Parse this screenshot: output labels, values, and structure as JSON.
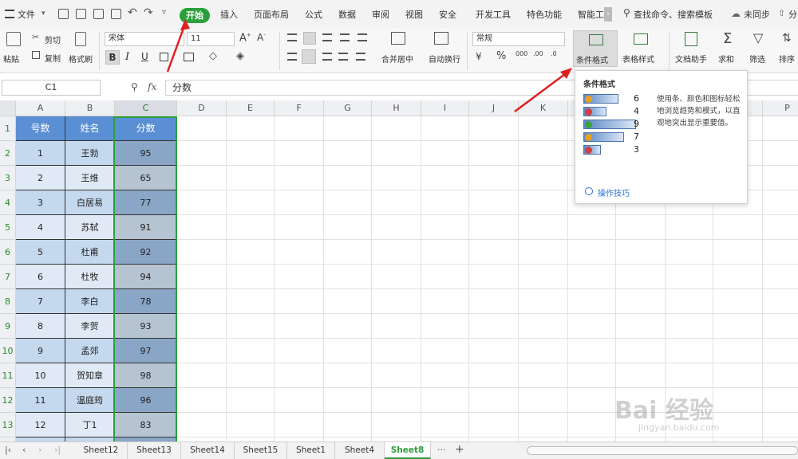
{
  "menu": {
    "file": "文件",
    "tabs": [
      "开始",
      "插入",
      "页面布局",
      "公式",
      "数据",
      "审阅",
      "视图",
      "安全",
      "开发工具",
      "特色功能",
      "智能工"
    ],
    "search": "查找命令、搜索模板",
    "sync": "未同步",
    "share": "分"
  },
  "ribbon": {
    "paste": "粘贴",
    "cut": "剪切",
    "copy": "复制",
    "format_painter": "格式刷",
    "font_name": "宋体",
    "font_size": "11",
    "merge_center": "合并居中",
    "auto_wrap": "自动换行",
    "number_format": "常规",
    "cond_format": "条件格式",
    "table_style": "表格样式",
    "doc_assistant": "文档助手",
    "sum": "求和",
    "filter": "筛选",
    "sort": "排序"
  },
  "formula_bar": {
    "cell_ref": "C1",
    "fx": "fx",
    "content": "分数"
  },
  "columns": [
    "A",
    "B",
    "C",
    "D",
    "E",
    "F",
    "G",
    "H",
    "I",
    "J",
    "K",
    "L",
    "M",
    "N",
    "O",
    "P"
  ],
  "rows": [
    "1",
    "2",
    "3",
    "4",
    "5",
    "6",
    "7",
    "8",
    "9",
    "10",
    "11",
    "12",
    "13"
  ],
  "table": {
    "headers": [
      "号数",
      "姓名",
      "分数"
    ],
    "rows": [
      [
        "1",
        "王勃",
        "95"
      ],
      [
        "2",
        "王维",
        "65"
      ],
      [
        "3",
        "白居易",
        "77"
      ],
      [
        "4",
        "苏轼",
        "91"
      ],
      [
        "5",
        "杜甫",
        "92"
      ],
      [
        "6",
        "杜牧",
        "94"
      ],
      [
        "7",
        "李白",
        "78"
      ],
      [
        "8",
        "李贺",
        "93"
      ],
      [
        "9",
        "孟郊",
        "97"
      ],
      [
        "10",
        "贺知章",
        "98"
      ],
      [
        "11",
        "温庭筠",
        "96"
      ],
      [
        "12",
        "丁1",
        "83"
      ]
    ]
  },
  "tooltip": {
    "title": "条件格式",
    "description": "使用条、颜色和图标轻松地浏览趋势和模式，以直观地突出显示重要值。",
    "sample_values": [
      "6",
      "4",
      "9",
      "7",
      "3"
    ],
    "link": "操作技巧"
  },
  "sheets": [
    "Sheet12",
    "Sheet13",
    "Sheet14",
    "Sheet15",
    "Sheet1",
    "Sheet4",
    "Sheet8"
  ],
  "active_sheet": "Sheet8",
  "watermark": {
    "brand": "Bai 经验",
    "url": "jingyan.baidu.com"
  }
}
